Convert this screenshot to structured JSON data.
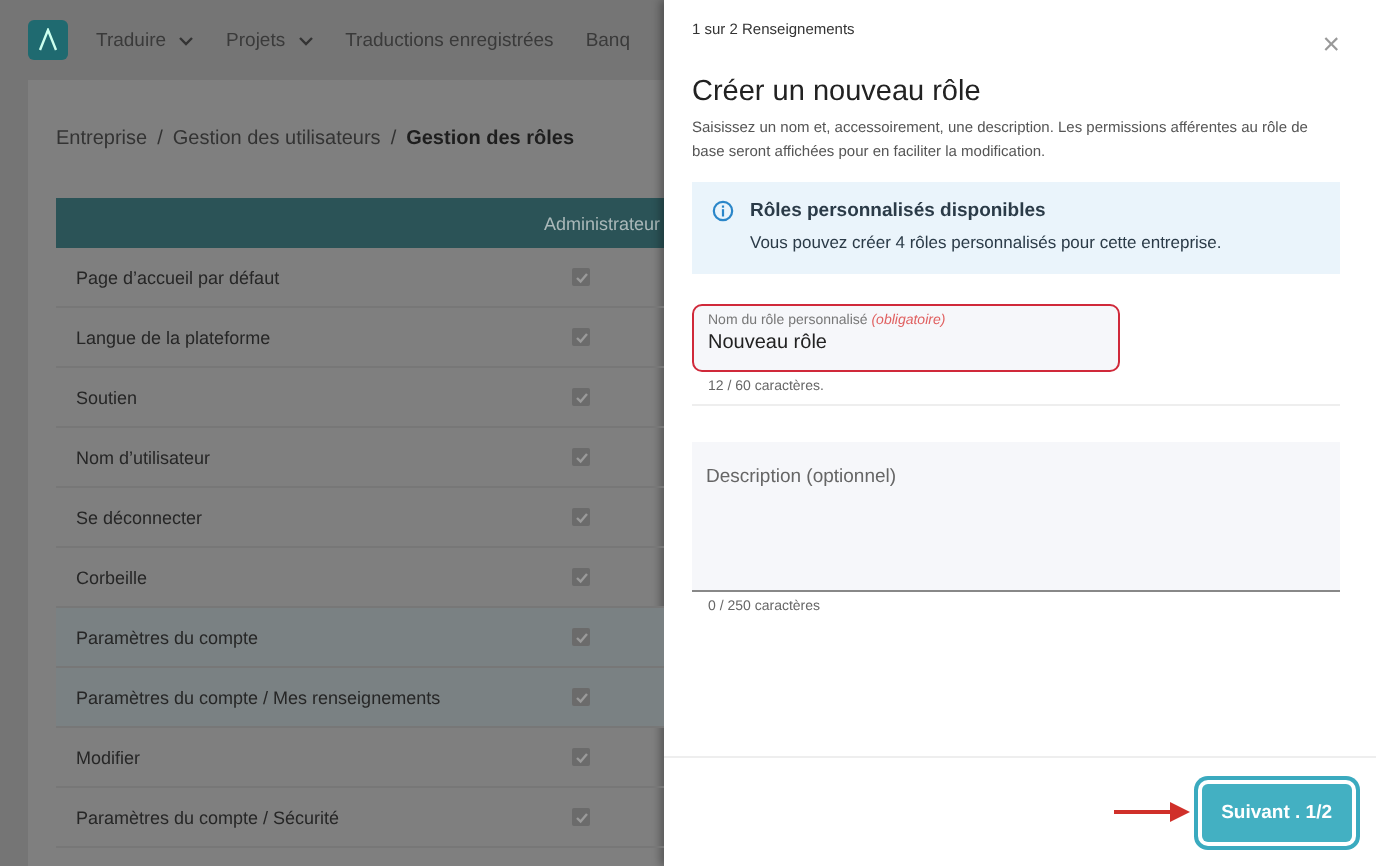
{
  "nav": {
    "items": [
      {
        "label": "Traduire",
        "dropdown": true
      },
      {
        "label": "Projets",
        "dropdown": true
      },
      {
        "label": "Traductions enregistrées",
        "dropdown": false
      },
      {
        "label": "Banq",
        "dropdown": false
      }
    ]
  },
  "breadcrumb": [
    {
      "kind": "link",
      "label": "Entreprise",
      "current": false
    },
    {
      "kind": "separator",
      "label": "/"
    },
    {
      "kind": "link",
      "label": "Gestion des utilisateurs",
      "current": false
    },
    {
      "kind": "separator",
      "label": "/"
    },
    {
      "kind": "link",
      "label": "Gestion des rôles",
      "current": true
    }
  ],
  "table": {
    "columns": [
      "Administrateur"
    ],
    "rows": [
      {
        "label": "Page d’accueil par défaut",
        "checked": true,
        "highlighted": false
      },
      {
        "label": "Langue de la plateforme",
        "checked": true,
        "highlighted": false
      },
      {
        "label": "Soutien",
        "checked": true,
        "highlighted": false
      },
      {
        "label": "Nom d’utilisateur",
        "checked": true,
        "highlighted": false
      },
      {
        "label": "Se déconnecter",
        "checked": true,
        "highlighted": false
      },
      {
        "label": "Corbeille",
        "checked": true,
        "highlighted": false
      },
      {
        "label": "Paramètres du compte",
        "checked": true,
        "highlighted": true
      },
      {
        "label": "Paramètres du compte / Mes renseignements",
        "checked": true,
        "highlighted": true
      },
      {
        "label": "Modifier",
        "checked": true,
        "highlighted": false
      },
      {
        "label": "Paramètres du compte / Sécurité",
        "checked": true,
        "highlighted": false
      }
    ]
  },
  "panel": {
    "step": "1 sur 2 Renseignements",
    "close": "×",
    "title": "Créer un nouveau rôle",
    "description": "Saisissez un nom et, accessoirement, une description. Les permissions afférentes au rôle de base seront affichées pour en faciliter la modification.",
    "info": {
      "title": "Rôles personnalisés disponibles",
      "text": "Vous pouvez créer 4 rôles personnalisés pour cette entreprise."
    },
    "name_field": {
      "label": "Nom du rôle personnalisé",
      "required": "(obligatoire)",
      "value": "Nouveau rôle",
      "counter": "12 / 60 caractères.",
      "highlighted": true
    },
    "description_field": {
      "placeholder": "Description (optionnel)",
      "counter": "0 / 250 caractères"
    },
    "next_button": {
      "label": "Suivant . 1/2",
      "highlighted": true
    }
  }
}
